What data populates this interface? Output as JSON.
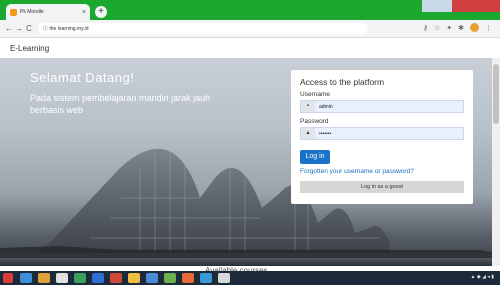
{
  "browser": {
    "tab_title": "Pk Moodle",
    "tab_close": "×",
    "new_tab": "+",
    "url": "ⓘ  the learning.my.id",
    "back": "←",
    "forward": "→",
    "reload": "C"
  },
  "site": {
    "brand": "E-Learning"
  },
  "hero": {
    "welcome": "Selamat Datang!",
    "subtitle": "Pada sistem pembelajaran mandiri jarak jauh berbasis web"
  },
  "login": {
    "title": "Access to the platform",
    "username_label": "Username",
    "username_value": "admin",
    "password_label": "Password",
    "password_value": "•••••••",
    "login_button": "Log in",
    "forgot_link": "Forgotten your username or password?",
    "guest_button": "Log in as a guest"
  },
  "below": {
    "available_courses": "Available courses"
  },
  "colors": {
    "tabstrip": "#1aa82f",
    "primary": "#1a73c9"
  }
}
